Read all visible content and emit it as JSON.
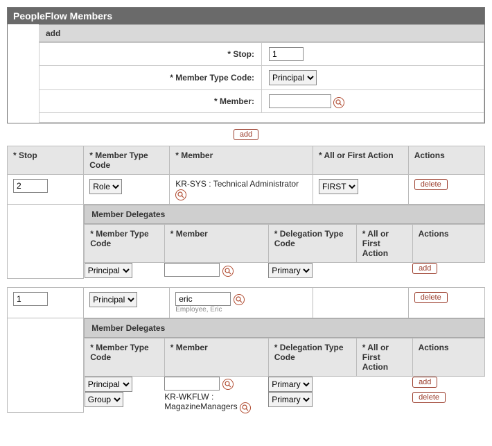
{
  "panel": {
    "title": "PeopleFlow Members"
  },
  "addSection": {
    "title": "add",
    "fields": {
      "stopLabel": "* Stop:",
      "stopValue": "1",
      "memberTypeLabel": "* Member Type Code:",
      "memberTypeValue": "Principal",
      "memberLabel": "* Member:",
      "memberValue": ""
    },
    "addButton": "add"
  },
  "membersGrid": {
    "headers": {
      "stop": "* Stop",
      "memberType": "* Member Type Code",
      "member": "* Member",
      "action": "* All or First Action",
      "actions": "Actions"
    },
    "rows": [
      {
        "stop": "2",
        "memberType": "Role",
        "memberText": "KR-SYS : Technical Administrator",
        "memberInput": "",
        "showMemberInput": false,
        "memberHint": "",
        "action": "FIRST",
        "actionBtn": "delete",
        "delegates": {
          "title": "Member Delegates",
          "headers": {
            "memberType": "* Member Type Code",
            "member": "* Member",
            "delegationType": "* Delegation Type Code",
            "action": "* All or First Action",
            "actions": "Actions"
          },
          "rows": [
            {
              "memberType": "Principal",
              "memberInput": "",
              "memberText": "",
              "delegationType": "Primary",
              "action": "",
              "actionBtn": "add"
            }
          ]
        }
      },
      {
        "stop": "1",
        "memberType": "Principal",
        "memberText": "",
        "memberInput": "eric",
        "showMemberInput": true,
        "memberHint": "Employee, Eric",
        "action": "",
        "actionBtn": "delete",
        "delegates": {
          "title": "Member Delegates",
          "headers": {
            "memberType": "* Member Type Code",
            "member": "* Member",
            "delegationType": "* Delegation Type Code",
            "action": "* All or First Action",
            "actions": "Actions"
          },
          "rows": [
            {
              "memberType": "Principal",
              "memberInput": "",
              "memberText": "",
              "delegationType": "Primary",
              "action": "",
              "actionBtn": "add"
            },
            {
              "memberType": "Group",
              "memberInput": "",
              "memberText": "KR-WKFLW : MagazineManagers",
              "delegationType": "Primary",
              "action": "",
              "actionBtn": "delete"
            }
          ]
        }
      }
    ]
  }
}
